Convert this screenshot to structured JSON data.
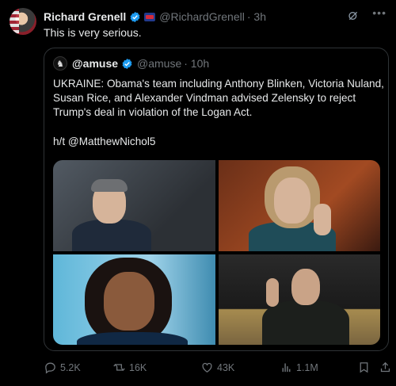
{
  "post": {
    "author_name": "Richard Grenell",
    "author_handle": "@RichardGrenell",
    "time": "· 3h",
    "text": "This is very serious."
  },
  "quote": {
    "author_name": "@amuse",
    "author_handle": "@amuse",
    "time": "· 10h",
    "text_main": "UKRAINE: Obama's team including Anthony Blinken, Victoria Nuland, Susan Rice, and Alexander Vindman advised Zelensky to reject Trump's deal in violation of the Logan Act.",
    "text_credit": "h/t @MatthewNichol5",
    "photos": [
      "photo-1",
      "photo-2",
      "photo-3",
      "photo-4"
    ]
  },
  "actions": {
    "replies": "5.2K",
    "reposts": "16K",
    "likes": "43K",
    "views": "1.1M"
  },
  "icons": {
    "verified": "verified-badge-icon",
    "affiliation": "affiliation-badge-icon",
    "grok": "grok-icon",
    "more": "more-icon",
    "reply": "reply-icon",
    "repost": "repost-icon",
    "like": "like-icon",
    "views": "views-icon",
    "bookmark": "bookmark-icon",
    "share": "share-icon"
  },
  "colors": {
    "background": "#000000",
    "text": "#e7e9ea",
    "muted": "#71767b",
    "verified": "#1d9bf0",
    "border": "#2f3336"
  }
}
